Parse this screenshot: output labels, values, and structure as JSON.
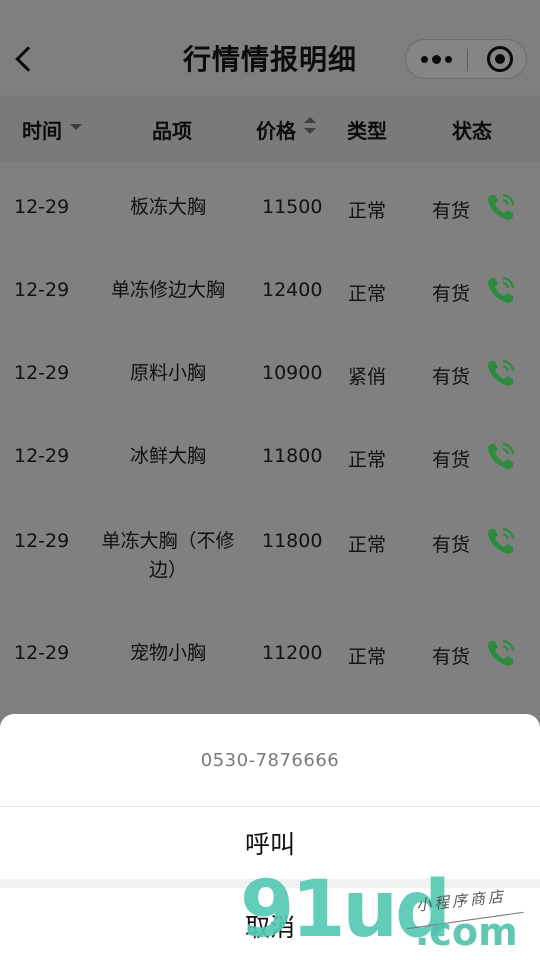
{
  "nav": {
    "title": "行情情报明细"
  },
  "table": {
    "headers": {
      "time": "时间",
      "item": "品项",
      "price": "价格",
      "type": "类型",
      "status": "状态"
    },
    "rows": [
      {
        "date": "12-29",
        "item": "板冻大胸",
        "price": "11500",
        "type": "正常",
        "status": "有货"
      },
      {
        "date": "12-29",
        "item": "单冻修边大胸",
        "price": "12400",
        "type": "正常",
        "status": "有货"
      },
      {
        "date": "12-29",
        "item": "原料小胸",
        "price": "10900",
        "type": "紧俏",
        "status": "有货"
      },
      {
        "date": "12-29",
        "item": "冰鲜大胸",
        "price": "11800",
        "type": "正常",
        "status": "有货"
      },
      {
        "date": "12-29",
        "item": "单冻大胸（不修边）",
        "price": "11800",
        "type": "正常",
        "status": "有货"
      },
      {
        "date": "12-29",
        "item": "宠物小胸",
        "price": "11200",
        "type": "正常",
        "status": "有货"
      }
    ]
  },
  "action_sheet": {
    "phone_number": "0530-7876666",
    "call_label": "呼叫",
    "cancel_label": "取消"
  },
  "watermark": {
    "big_text": "91ud",
    "domain_text": ".com",
    "small_text": "小程序商店"
  },
  "colors": {
    "phone_icon": "#2e8b3e",
    "overlay": "#7f7f7f",
    "watermark": "#55c9b4"
  }
}
